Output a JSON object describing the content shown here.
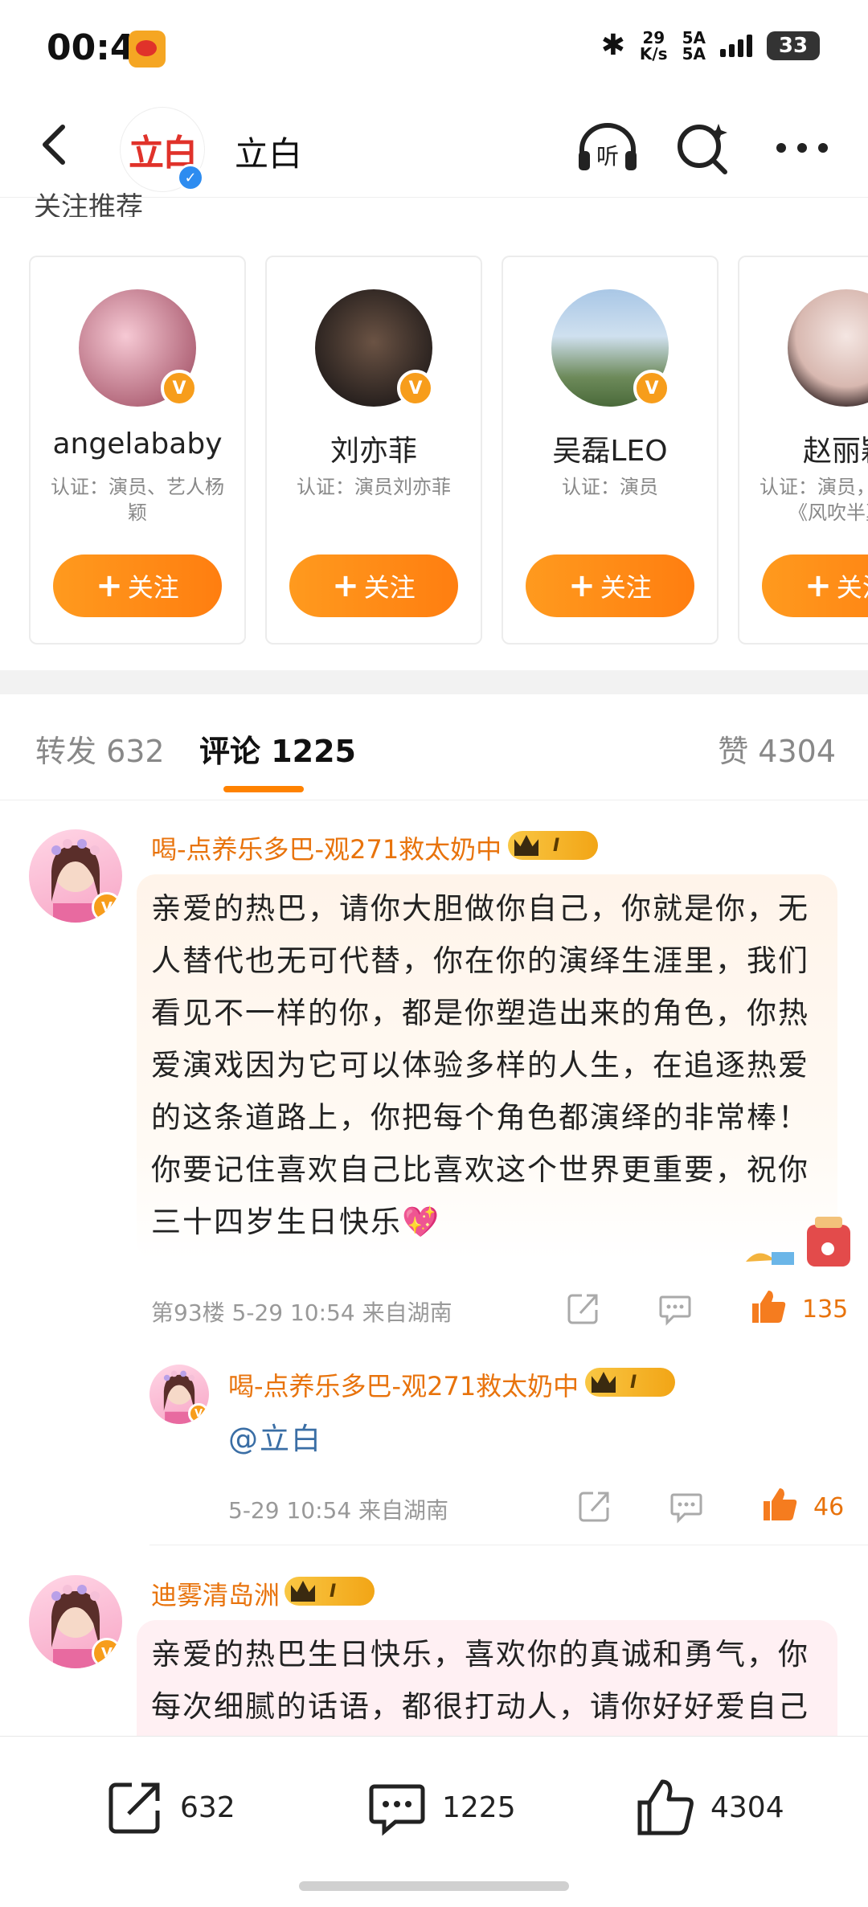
{
  "status_bar": {
    "time": "00:45",
    "net_speed_value": "29",
    "net_speed_unit": "K/s",
    "net_type_1": "5A",
    "net_type_2": "5A",
    "battery": "33"
  },
  "header": {
    "title": "立白",
    "avatar_logo_text": "立白",
    "listen_label": "听"
  },
  "recommend": {
    "section_title": "关注推荐",
    "cards": [
      {
        "name": "angelababy",
        "cert": "认证：演员、艺人杨颖",
        "follow_label": "关注"
      },
      {
        "name": "刘亦菲",
        "cert": "认证：演员刘亦菲",
        "follow_label": "关注"
      },
      {
        "name": "吴磊LEO",
        "cert": "认证：演员",
        "follow_label": "关注"
      },
      {
        "name": "赵丽颖",
        "cert": "认证：演员，代表作《风吹半夏》",
        "follow_label": "关注"
      }
    ]
  },
  "tabs": {
    "repost": "转发 632",
    "comment": "评论 1225",
    "like": "赞 4304"
  },
  "comments": [
    {
      "username": "喝-点养乐多巴-观271救太奶中",
      "badge_level": "I",
      "text": "亲爱的热巴，请你大胆做你自己，你就是你，无人替代也无可代替，你在你的演绎生涯里，我们看见不一样的你，都是你塑造出来的角色，你热爱演戏因为它可以体验多样的人生，在追逐热爱的这条道路上，你把每个角色都演绎的非常棒！你要记住喜欢自己比喜欢这个世界更重要，祝你三十四岁生日快乐💖",
      "meta": "第93楼  5-29 10:54  来自湖南",
      "likes": "135",
      "reply": {
        "username": "喝-点养乐多巴-观271救太奶中",
        "badge_level": "I",
        "text": "@立白",
        "meta": "5-29 10:54  来自湖南",
        "likes": "46"
      }
    },
    {
      "username": "迪雾清岛洲",
      "badge_level": "I",
      "text": "亲爱的热巴生日快乐，喜欢你的真诚和勇气，你每次细腻的话语，都很打动人，请你好好爱自己胜过"
    }
  ],
  "bottom_bar": {
    "repost_count": "632",
    "comment_count": "1225",
    "like_count": "4304"
  },
  "colors": {
    "accent_orange": "#ff8200",
    "username_orange": "#e8730c",
    "verified_orange": "#f79d1b",
    "verified_blue": "#2d8cf0"
  }
}
